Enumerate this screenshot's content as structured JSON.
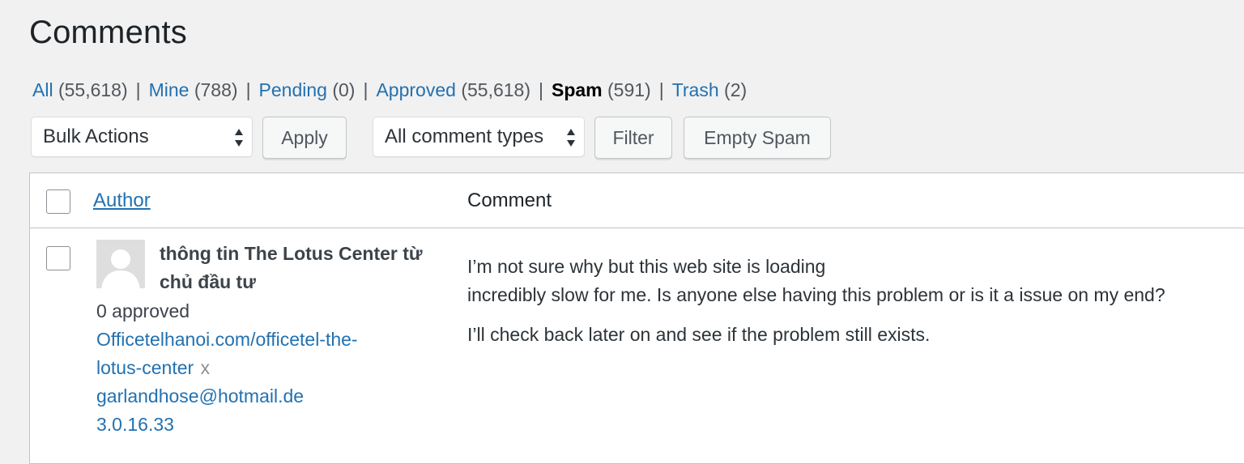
{
  "page": {
    "title": "Comments"
  },
  "filters": [
    {
      "label": "All",
      "count": "(55,618)",
      "current": false
    },
    {
      "label": "Mine",
      "count": "(788)",
      "current": false
    },
    {
      "label": "Pending",
      "count": "(0)",
      "current": false
    },
    {
      "label": "Approved",
      "count": "(55,618)",
      "current": false
    },
    {
      "label": "Spam",
      "count": "(591)",
      "current": true
    },
    {
      "label": "Trash",
      "count": "(2)",
      "current": false
    }
  ],
  "separator": "|",
  "toolbar": {
    "bulk_actions": "Bulk Actions",
    "apply_label": "Apply",
    "comment_types": "All comment types",
    "filter_label": "Filter",
    "empty_spam_label": "Empty Spam"
  },
  "table": {
    "headers": {
      "author": "Author",
      "comment": "Comment"
    },
    "rows": [
      {
        "author_name": "thông tin The Lotus Center từ chủ đầu tư",
        "approved": "0 approved",
        "url_line1": "Officetelhanoi.com/officetel-the-",
        "url_line2": "lotus-center",
        "remove_x": "x",
        "email": "garlandhose@hotmail.de",
        "ip": "3.0.16.33",
        "comment_p1_line1": "I’m not sure why but this web site is loading",
        "comment_p1_line2": "incredibly slow for me. Is anyone else having this problem or is it a issue on my end?",
        "comment_p2": "I’ll check back later on and see if the problem still exists."
      }
    ]
  },
  "colors": {
    "link": "#2271b1",
    "background": "#f1f1f1",
    "text": "#3c434a"
  }
}
